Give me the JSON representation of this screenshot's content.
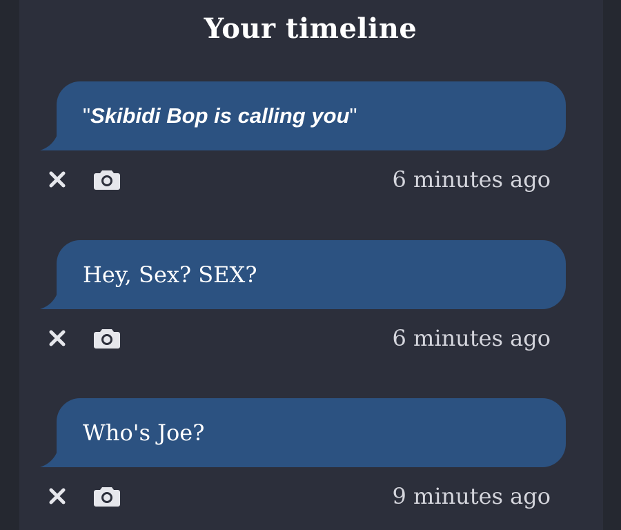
{
  "header": {
    "title": "Your timeline"
  },
  "colors": {
    "background": "#252830",
    "panel": "#2c2f3b",
    "bubble": "#2c5281",
    "text": "#ffffff",
    "muted": "#d4d5dc"
  },
  "entries": [
    {
      "quote_open": "\"",
      "message": "Skibidi Bop is calling you",
      "quote_close": "\"",
      "time": "6 minutes ago",
      "delete_icon": "close-icon",
      "camera_icon": "camera-icon"
    },
    {
      "message": "Hey, Sex? SEX?",
      "time": "6 minutes ago",
      "delete_icon": "close-icon",
      "camera_icon": "camera-icon"
    },
    {
      "message": "Who's Joe?",
      "time": "9 minutes ago",
      "delete_icon": "close-icon",
      "camera_icon": "camera-icon"
    }
  ]
}
